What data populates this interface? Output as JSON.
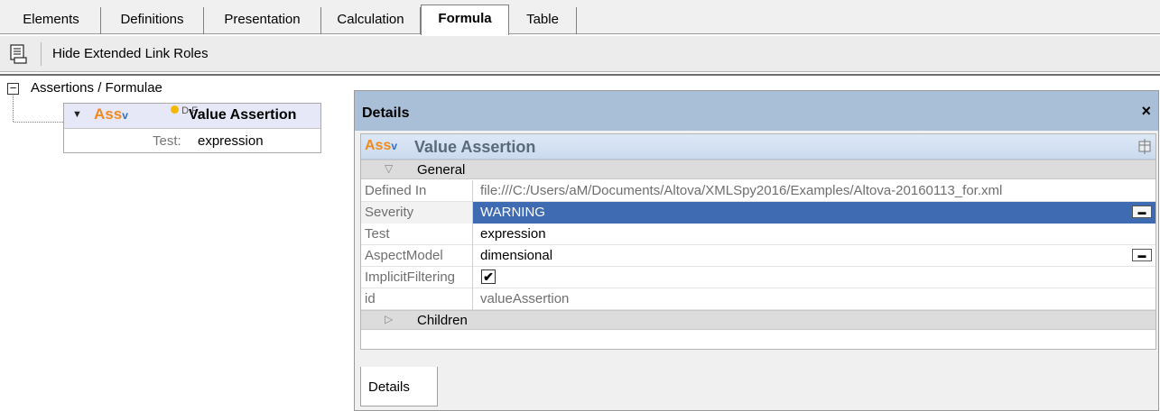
{
  "tabs": [
    {
      "label": "Elements"
    },
    {
      "label": "Definitions"
    },
    {
      "label": "Presentation"
    },
    {
      "label": "Calculation"
    },
    {
      "label": "Formula"
    },
    {
      "label": "Table"
    }
  ],
  "toolbar": {
    "icon": "extended-link-roles-icon",
    "hide_roles_label": "Hide Extended Link Roles"
  },
  "tree": {
    "root_label": "Assertions / Formulae",
    "toggle_symbol": "⊟",
    "node": {
      "ass_label": "Ass",
      "ass_sub": "v",
      "odf_label": "D F",
      "title": "Value Assertion",
      "test_label": "Test:",
      "test_value": "expression"
    }
  },
  "details": {
    "title": "Details",
    "close_symbol": "×",
    "header": {
      "ass_label": "Ass",
      "ass_sub": "v",
      "title": "Value Assertion"
    },
    "general_group": {
      "arrow": "▽",
      "label": "General"
    },
    "properties": [
      {
        "name": "Defined In",
        "value": "file:///C:/Users/aM/Documents/Altova/XMLSpy2016/Examples/Altova-20160113_for.xml"
      },
      {
        "name": "Severity",
        "value": "WARNING"
      },
      {
        "name": "Test",
        "value": "expression"
      },
      {
        "name": "AspectModel",
        "value": "dimensional"
      },
      {
        "name": "ImplicitFiltering",
        "value": "✔"
      },
      {
        "name": "id",
        "value": "valueAssertion"
      }
    ],
    "children_group": {
      "arrow": "▷",
      "label": "Children"
    },
    "bottom_tab_label": "Details"
  },
  "colors": {
    "accent_orange": "#f08a1e",
    "accent_blue": "#2f72c4",
    "selection": "#3f6bb2",
    "details_header": "#a9bfd8"
  }
}
